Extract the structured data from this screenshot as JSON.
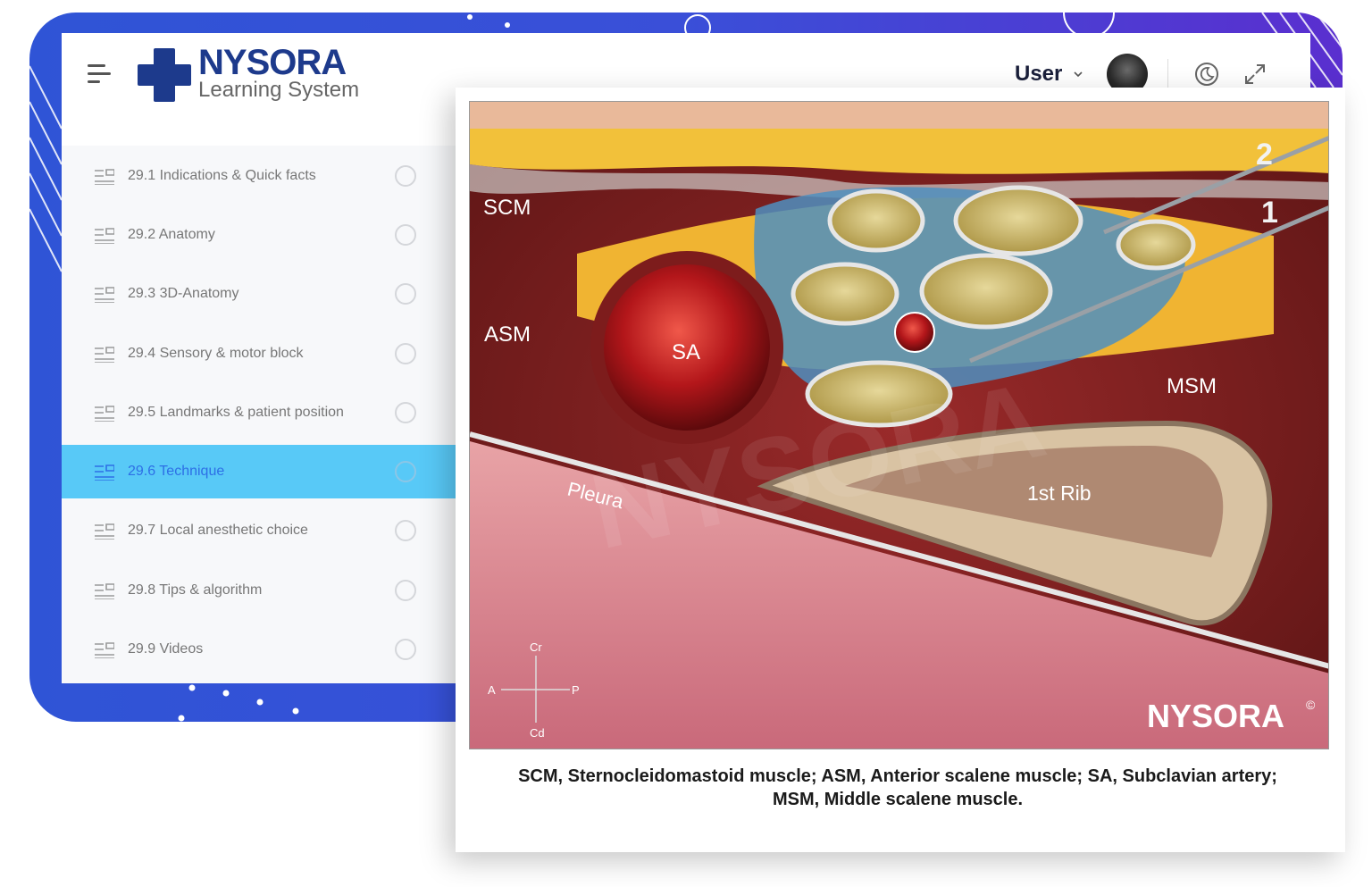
{
  "header": {
    "brand_name": "NYSORA",
    "brand_subtitle": "Learning System",
    "user_label": "User",
    "icons": [
      "menu-icon",
      "chevron-down-icon",
      "moon-icon",
      "fullscreen-icon"
    ]
  },
  "sidebar": {
    "items": [
      {
        "label": "29.1 Indications & Quick facts",
        "active": false
      },
      {
        "label": "29.2 Anatomy",
        "active": false
      },
      {
        "label": "29.3 3D-Anatomy",
        "active": false
      },
      {
        "label": "29.4 Sensory & motor block",
        "active": false
      },
      {
        "label": "29.5 Landmarks & patient position",
        "active": false
      },
      {
        "label": "29.6 Technique",
        "active": true
      },
      {
        "label": "29.7 Local anesthetic choice",
        "active": false
      },
      {
        "label": "29.8 Tips & algorithm",
        "active": false
      },
      {
        "label": "29.9 Videos",
        "active": false
      }
    ]
  },
  "figure": {
    "labels": {
      "scm": "SCM",
      "asm": "ASM",
      "sa": "SA",
      "msm": "MSM",
      "pleura": "Pleura",
      "rib": "1st Rib",
      "needle_1": "1",
      "needle_2": "2",
      "axis_cr": "Cr",
      "axis_cd": "Cd",
      "axis_a": "A",
      "axis_p": "P"
    },
    "watermark": "NYSORA",
    "copyright_mark": "©"
  },
  "caption": {
    "line1": "SCM, Sternocleidomastoid muscle; ASM, Anterior scalene muscle; SA, Subclavian artery;",
    "line2": "MSM, Middle scalene muscle."
  },
  "colors": {
    "frame_blue": "#2f54d6",
    "frame_purple": "#5a2fcf",
    "active_item": "#58c9f7",
    "brand_navy": "#1d3a8c"
  }
}
